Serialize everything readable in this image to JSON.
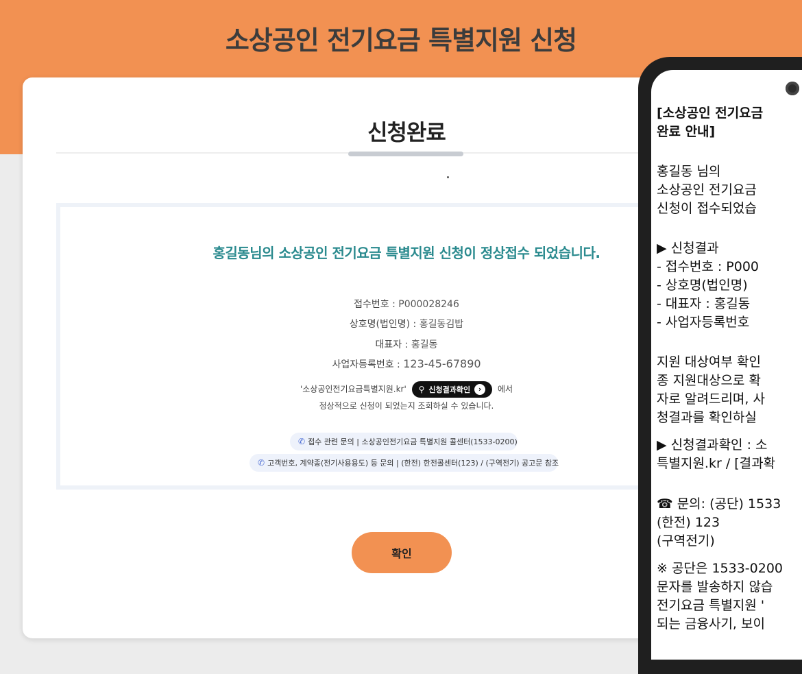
{
  "header": {
    "title": "소상공인 전기요금 특별지원 신청"
  },
  "main": {
    "section_title": "신청완료",
    "success_message": "홍길동님의 소상공인 전기요금 특별지원 신청이 정상접수 되었습니다.",
    "details": [
      {
        "label": "접수번호 : ",
        "value": "P000028246"
      },
      {
        "label": "상호명(법인명) : ",
        "value": "홍길동김밥"
      },
      {
        "label": "대표자 : ",
        "value": "홍길동"
      },
      {
        "label": "사업자등록번호 : ",
        "value": "123-45-67890"
      }
    ],
    "notice": {
      "prefix": "'소상공인전기요금특별지원.kr'",
      "button_label": "신청결과확인",
      "suffix": "에서",
      "line2": "정상적으로 신청이 되었는지 조회하실 수 있습니다."
    },
    "contacts": [
      "접수 관련 문의 | 소상공인전기요금 특별지원 콜센터(1533-0200)",
      "고객번호, 계약종(전기사용용도) 등 문의 | (한전) 한전콜센터(123) / (구역전기) 공고문 참조"
    ],
    "confirm_label": "확인"
  },
  "phone": {
    "lines": [
      "[소상공인 전기요금",
      " 완료 안내]",
      " 홍길동 님의",
      " 소상공인 전기요금",
      " 신청이 접수되었습",
      " ▶ 신청결과",
      "-    접수번호 : P000",
      "-    상호명(법인명)",
      "-    대표자 : 홍길동",
      "-    사업자등록번호",
      " 지원 대상여부 확인",
      " 종 지원대상으로 확",
      " 자로 알려드리며, 사",
      " 청결과를 확인하실",
      "▶ 신청결과확인 : 소",
      "특별지원.kr / [결과확",
      "☎ 문의: (공단) 1533",
      "         (한전) 123",
      "         (구역전기)",
      "※ 공단은 1533-0200",
      "문자를 발송하지 않습",
      "전기요금 특별지원 '",
      "되는 금융사기, 보이"
    ]
  }
}
